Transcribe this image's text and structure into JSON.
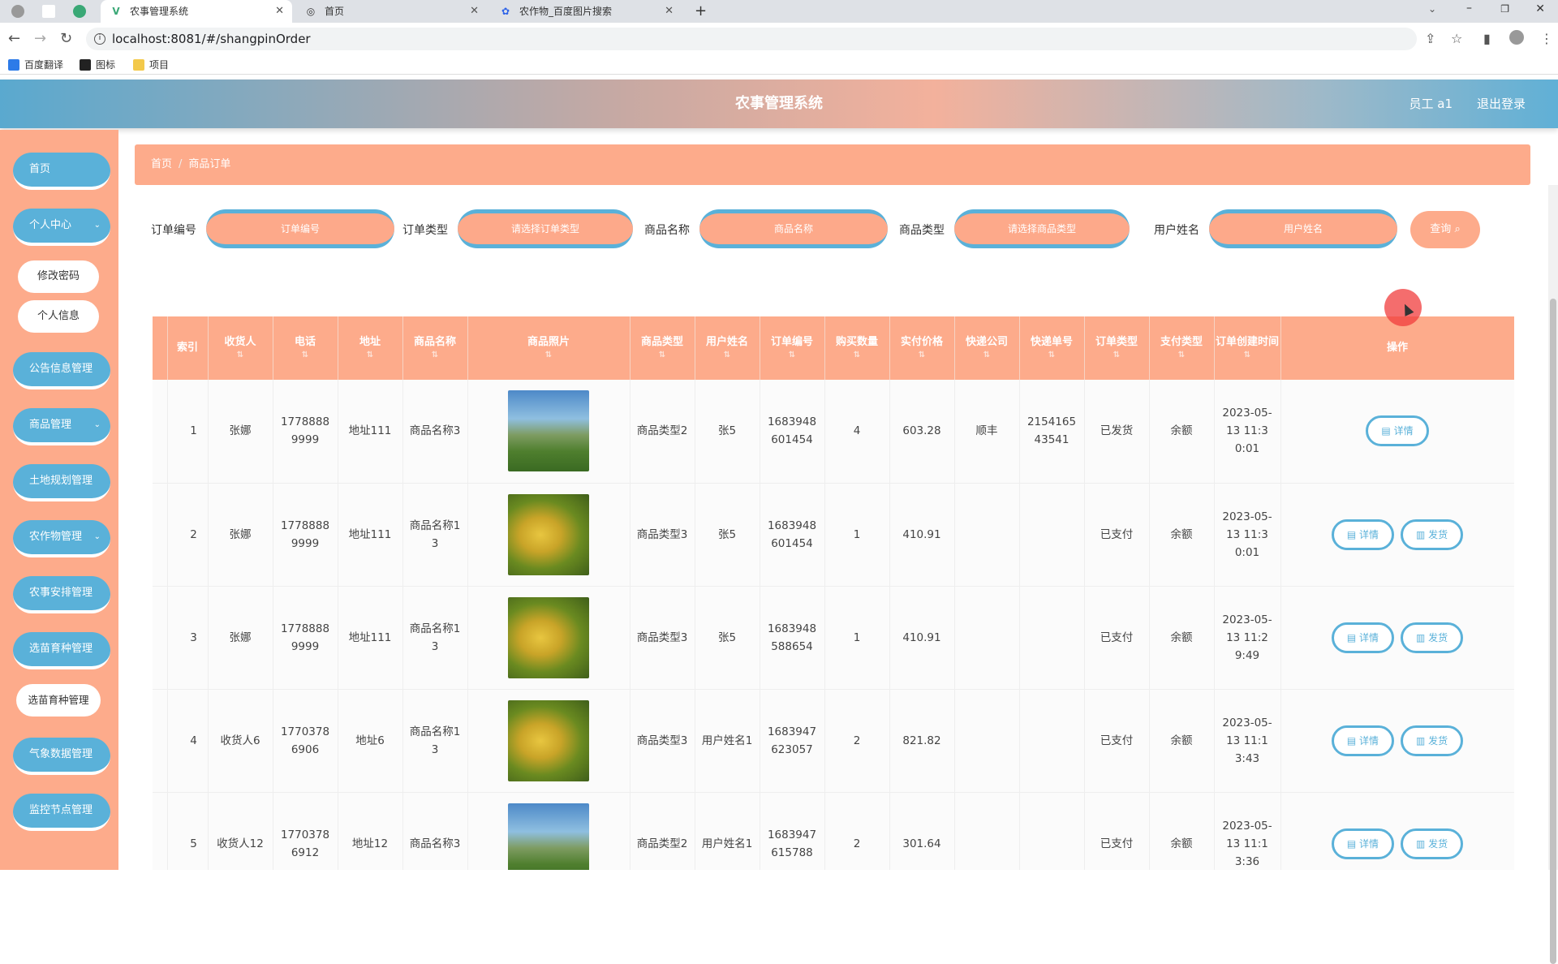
{
  "browser": {
    "tabs": [
      {
        "title": "农事管理系统",
        "icon": "vue-icon"
      },
      {
        "title": "首页",
        "icon": "globe-icon"
      },
      {
        "title": "农作物_百度图片搜索",
        "icon": "baidu-icon"
      }
    ],
    "url": "localhost:8081/#/shangpinOrder",
    "bookmarks": [
      "百度翻译",
      "图标",
      "项目"
    ]
  },
  "header": {
    "title": "农事管理系统",
    "user": "员工 a1",
    "logout": "退出登录"
  },
  "sidebar": {
    "items": [
      {
        "label": "首页",
        "top": 0
      },
      {
        "label": "个人中心"
      },
      {
        "label": "修改密码"
      },
      {
        "label": "个人信息"
      },
      {
        "label": "公告信息管理"
      },
      {
        "label": "商品管理"
      },
      {
        "label": "土地规划管理"
      },
      {
        "label": "农作物管理"
      },
      {
        "label": "农事安排管理"
      },
      {
        "label": "选苗育种管理"
      },
      {
        "label": "选苗育种管理"
      },
      {
        "label": "气象数据管理"
      },
      {
        "label": "监控节点管理"
      }
    ]
  },
  "breadcrumb": {
    "home": "首页",
    "current": "商品订单",
    "sep": "/"
  },
  "filters": {
    "order_no": {
      "label": "订单编号",
      "placeholder": "订单编号"
    },
    "order_type": {
      "label": "订单类型",
      "placeholder": "请选择订单类型"
    },
    "product_name": {
      "label": "商品名称",
      "placeholder": "商品名称"
    },
    "product_type": {
      "label": "商品类型",
      "placeholder": "请选择商品类型"
    },
    "user_name": {
      "label": "用户姓名",
      "placeholder": "用户姓名"
    },
    "query": "查询"
  },
  "table": {
    "columns": [
      "索引",
      "收货人",
      "电话",
      "地址",
      "商品名称",
      "商品照片",
      "商品类型",
      "用户姓名",
      "订单编号",
      "购买数量",
      "实付价格",
      "快递公司",
      "快递单号",
      "订单类型",
      "支付类型",
      "订单创建时间",
      "操作"
    ],
    "rows": [
      {
        "idx": "1",
        "receiver": "张娜",
        "phone": "17788889999",
        "addr": "地址111",
        "pname": "商品名称3",
        "photo": "blue",
        "ptype": "商品类型2",
        "uname": "张5",
        "order_no": "1683948601454",
        "qty": "4",
        "price": "603.28",
        "express": "顺丰",
        "express_no": "215416543541",
        "otype": "已发货",
        "paytype": "余额",
        "created": "2023-05-13 11:30:01",
        "actions": [
          "详情"
        ]
      },
      {
        "idx": "2",
        "receiver": "张娜",
        "phone": "17788889999",
        "addr": "地址111",
        "pname": "商品名称13",
        "photo": "rice",
        "ptype": "商品类型3",
        "uname": "张5",
        "order_no": "1683948601454",
        "qty": "1",
        "price": "410.91",
        "express": "",
        "express_no": "",
        "otype": "已支付",
        "paytype": "余额",
        "created": "2023-05-13 11:30:01",
        "actions": [
          "详情",
          "发货"
        ]
      },
      {
        "idx": "3",
        "receiver": "张娜",
        "phone": "17788889999",
        "addr": "地址111",
        "pname": "商品名称13",
        "photo": "rice",
        "ptype": "商品类型3",
        "uname": "张5",
        "order_no": "1683948588654",
        "qty": "1",
        "price": "410.91",
        "express": "",
        "express_no": "",
        "otype": "已支付",
        "paytype": "余额",
        "created": "2023-05-13 11:29:49",
        "actions": [
          "详情",
          "发货"
        ]
      },
      {
        "idx": "4",
        "receiver": "收货人6",
        "phone": "17703786906",
        "addr": "地址6",
        "pname": "商品名称13",
        "photo": "rice",
        "ptype": "商品类型3",
        "uname": "用户姓名1",
        "order_no": "1683947623057",
        "qty": "2",
        "price": "821.82",
        "express": "",
        "express_no": "",
        "otype": "已支付",
        "paytype": "余额",
        "created": "2023-05-13 11:13:43",
        "actions": [
          "详情",
          "发货"
        ]
      },
      {
        "idx": "5",
        "receiver": "收货人12",
        "phone": "17703786912",
        "addr": "地址12",
        "pname": "商品名称3",
        "photo": "blue",
        "ptype": "商品类型2",
        "uname": "用户姓名1",
        "order_no": "1683947615788",
        "qty": "2",
        "price": "301.64",
        "express": "",
        "express_no": "",
        "otype": "已支付",
        "paytype": "余额",
        "created": "2023-05-13 11:13:36",
        "actions": [
          "详情",
          "发货"
        ]
      }
    ]
  }
}
